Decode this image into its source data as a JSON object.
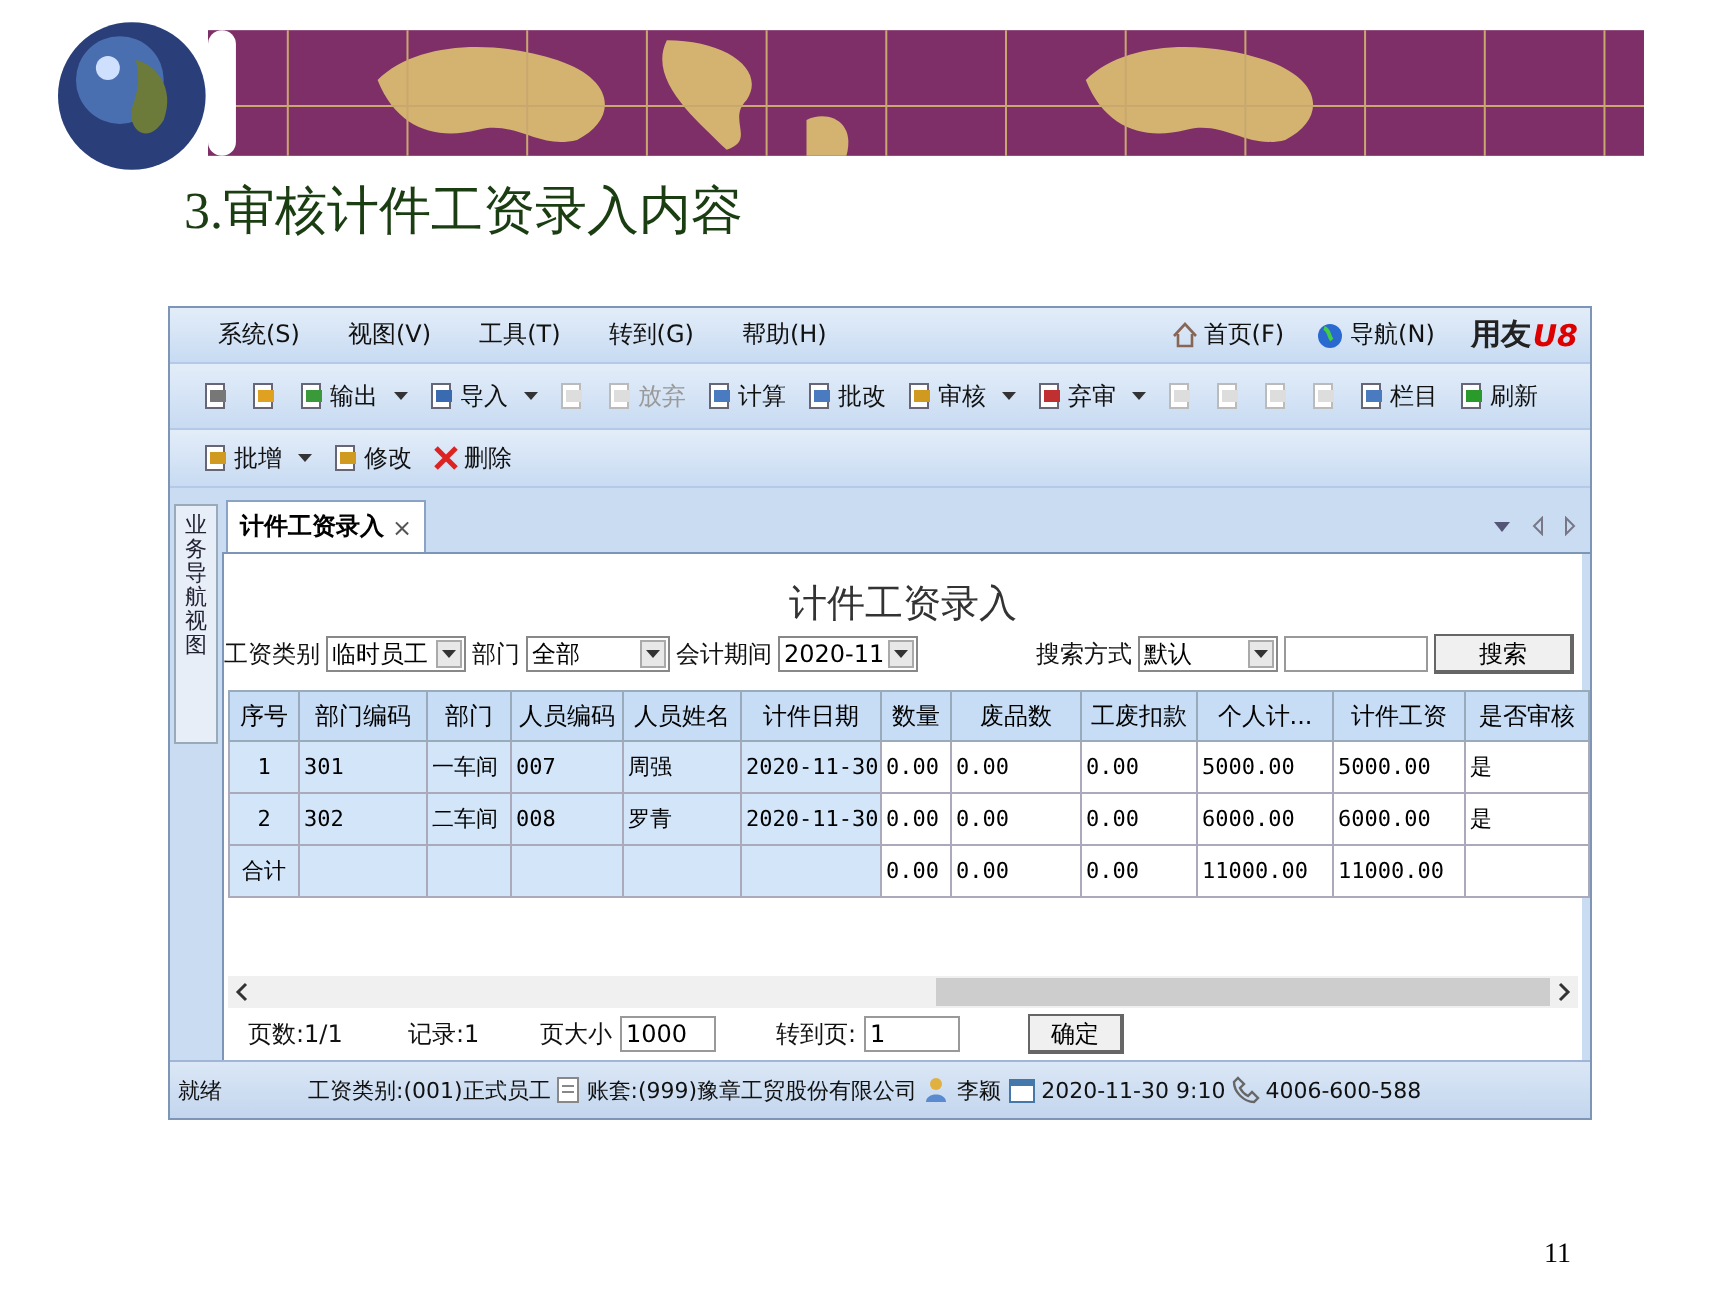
{
  "slide": {
    "title": "3.审核计件工资录入内容",
    "page_number": "11"
  },
  "window": {
    "menu": [
      "系统(S)",
      "视图(V)",
      "工具(T)",
      "转到(G)",
      "帮助(H)"
    ],
    "quick_links": [
      {
        "label": "首页(F)"
      },
      {
        "label": "导航(N)"
      }
    ],
    "logo": {
      "text": "用友",
      "mark": "U8"
    },
    "toolbar": [
      {
        "kind": "icon",
        "disabled": false
      },
      {
        "kind": "icon",
        "disabled": false
      },
      {
        "kind": "button",
        "label": "输出",
        "dropdown": true,
        "disabled": false
      },
      {
        "kind": "button",
        "label": "导入",
        "dropdown": true,
        "disabled": false
      },
      {
        "kind": "icon",
        "disabled": true
      },
      {
        "kind": "button",
        "label": "放弃",
        "dropdown": false,
        "disabled": true
      },
      {
        "kind": "button",
        "label": "计算",
        "dropdown": false,
        "disabled": false
      },
      {
        "kind": "button",
        "label": "批改",
        "dropdown": false,
        "disabled": false
      },
      {
        "kind": "button",
        "label": "审核",
        "dropdown": true,
        "disabled": false
      },
      {
        "kind": "button",
        "label": "弃审",
        "dropdown": true,
        "disabled": false
      },
      {
        "kind": "icon",
        "disabled": true
      },
      {
        "kind": "icon",
        "disabled": true
      },
      {
        "kind": "icon",
        "disabled": true
      },
      {
        "kind": "icon",
        "disabled": true
      },
      {
        "kind": "button",
        "label": "栏目",
        "dropdown": false,
        "disabled": false
      },
      {
        "kind": "button",
        "label": "刷新",
        "dropdown": false,
        "disabled": false
      }
    ],
    "toolbar2": [
      {
        "kind": "button",
        "label": "批增",
        "dropdown": true,
        "disabled": false
      },
      {
        "kind": "button",
        "label": "修改",
        "dropdown": false,
        "disabled": false
      },
      {
        "kind": "delete",
        "label": "删除",
        "dropdown": false,
        "disabled": false
      }
    ],
    "sidebar": {
      "label": "业务导航视图"
    },
    "tabs": [
      {
        "label": "计件工资录入",
        "selected": true,
        "close": "×"
      }
    ],
    "form": {
      "title": "计件工资录入",
      "filters": [
        {
          "label": "工资类别",
          "value": "临时员工"
        },
        {
          "label": "部门",
          "value": "全部"
        },
        {
          "label": "会计期间",
          "value": "2020-11"
        }
      ],
      "search_mode": {
        "label": "搜索方式",
        "value": "默认"
      },
      "search_button": "搜索"
    },
    "table": {
      "columns": [
        "序号",
        "部门编码",
        "部门",
        "人员编码",
        "人员姓名",
        "计件日期",
        "数量",
        "废品数",
        "工废扣款",
        "个人计...",
        "计件工资",
        "是否审核"
      ],
      "rows": [
        [
          "1",
          "301",
          "一车间",
          "007",
          "周强",
          "2020-11-30",
          "0.00",
          "0.00",
          "0.00",
          "5000.00",
          "5000.00",
          "是"
        ],
        [
          "2",
          "302",
          "二车间",
          "008",
          "罗青",
          "2020-11-30",
          "0.00",
          "0.00",
          "0.00",
          "6000.00",
          "6000.00",
          "是"
        ],
        [
          "合计",
          "",
          "",
          "",
          "",
          "",
          "0.00",
          "0.00",
          "0.00",
          "11000.00",
          "11000.00",
          ""
        ]
      ]
    },
    "pager": {
      "pages": "页数:1/1",
      "records": "记录:1",
      "page_size_label": "页大小",
      "page_size": "1000",
      "goto_label": "转到页:",
      "goto": "1",
      "ok": "确定"
    },
    "status_bar": [
      {
        "kind": "text",
        "text": "就绪"
      },
      {
        "kind": "text",
        "text": "工资类别:(001)正式员工"
      },
      {
        "kind": "doc",
        "text": "账套:(999)豫章工贸股份有限公司"
      },
      {
        "kind": "user",
        "text": "李颖"
      },
      {
        "kind": "calendar",
        "text": "2020-11-30 9:10"
      },
      {
        "kind": "phone",
        "text": "4006-600-588"
      }
    ]
  }
}
